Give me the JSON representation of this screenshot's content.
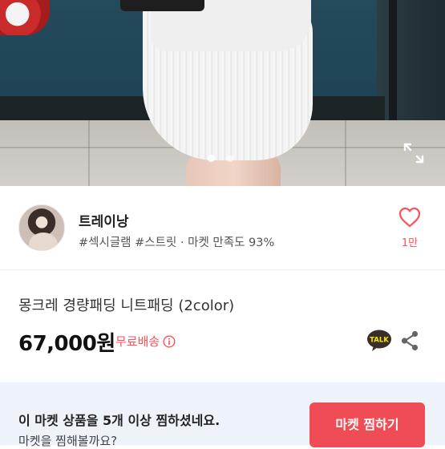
{
  "gallery": {
    "dot_count": 2,
    "active_index": 0
  },
  "seller": {
    "name": "트레이낭",
    "tags": "#섹시글램 #스트릿 · 마켓 만족도 93%",
    "like_count": "1만"
  },
  "product": {
    "title": "몽크레 경량패딩 니트패딩 (2color)",
    "price": "67,000원",
    "shipping": "무료배송"
  },
  "actions": {
    "talk_label": "TALK"
  },
  "banner": {
    "line1": "이 마켓 상품을 5개 이상 찜하셨네요.",
    "line2": "마켓을 찜해볼까요?",
    "cta_label": "마켓 찜하기"
  },
  "colors": {
    "accent": "#f04c55",
    "heart": "#ff4f5a",
    "banner_bg": "#eef3fa",
    "talk_bubble": "#3a2e2a"
  },
  "icons": {
    "expand": "expand-icon",
    "heart": "heart-icon",
    "info": "info-icon",
    "talk": "kakao-talk-icon",
    "share": "share-icon"
  }
}
